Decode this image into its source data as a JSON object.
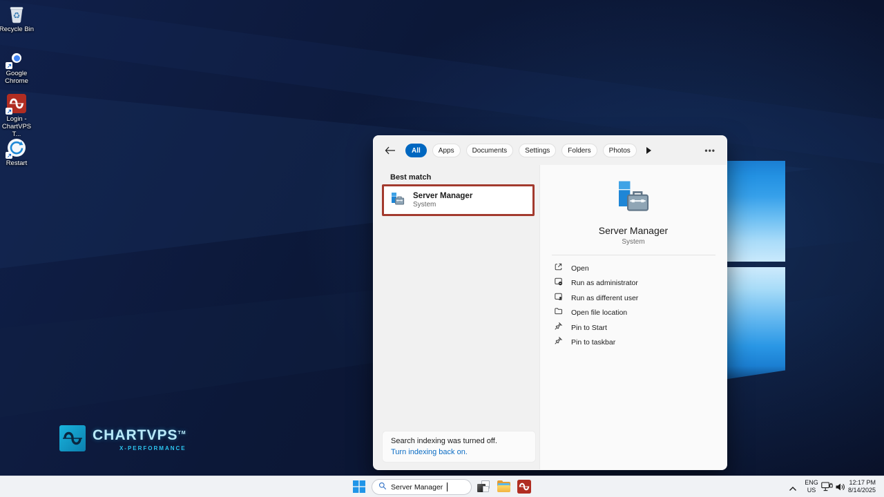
{
  "colors": {
    "accent": "#0067c0",
    "annotation_red": "#a33a2e",
    "link_blue": "#0a6cc4",
    "taskbar_bg": "#f0f2f5",
    "panel_bg": "#f1f1f1"
  },
  "desktop": {
    "icons": [
      {
        "label": "Recycle Bin",
        "icon": "recycle-bin-icon"
      },
      {
        "label": "Google Chrome",
        "icon": "chrome-icon"
      },
      {
        "label": "Login - ChartVPS T...",
        "icon": "chartvps-app-icon"
      },
      {
        "label": "Restart",
        "icon": "restart-icon"
      }
    ],
    "watermark": {
      "brand": "CHARTVPS",
      "tm": "TM",
      "tagline": "X-PERFORMANCE"
    }
  },
  "search_panel": {
    "tabs": [
      {
        "label": "All",
        "active": true
      },
      {
        "label": "Apps"
      },
      {
        "label": "Documents"
      },
      {
        "label": "Settings"
      },
      {
        "label": "Folders"
      },
      {
        "label": "Photos"
      }
    ],
    "ellipsis": "•••",
    "section_title": "Best match",
    "best_match": {
      "title": "Server Manager",
      "subtitle": "System",
      "icon": "server-manager-icon"
    },
    "detail": {
      "title": "Server Manager",
      "subtitle": "System",
      "icon": "server-manager-icon",
      "actions": [
        {
          "label": "Open",
          "icon": "open-external-icon"
        },
        {
          "label": "Run as administrator",
          "icon": "run-admin-icon"
        },
        {
          "label": "Run as different user",
          "icon": "run-user-icon"
        },
        {
          "label": "Open file location",
          "icon": "folder-outline-icon"
        },
        {
          "label": "Pin to Start",
          "icon": "pin-icon"
        },
        {
          "label": "Pin to taskbar",
          "icon": "pin-icon"
        }
      ]
    },
    "notice": {
      "text": "Search indexing was turned off.",
      "link": "Turn indexing back on."
    }
  },
  "taskbar": {
    "search": {
      "value": "Server Manager",
      "icon": "search-icon"
    },
    "tray": {
      "language": {
        "line1": "ENG",
        "line2": "US"
      },
      "time": "12:17 PM",
      "date": "8/14/2025"
    }
  }
}
